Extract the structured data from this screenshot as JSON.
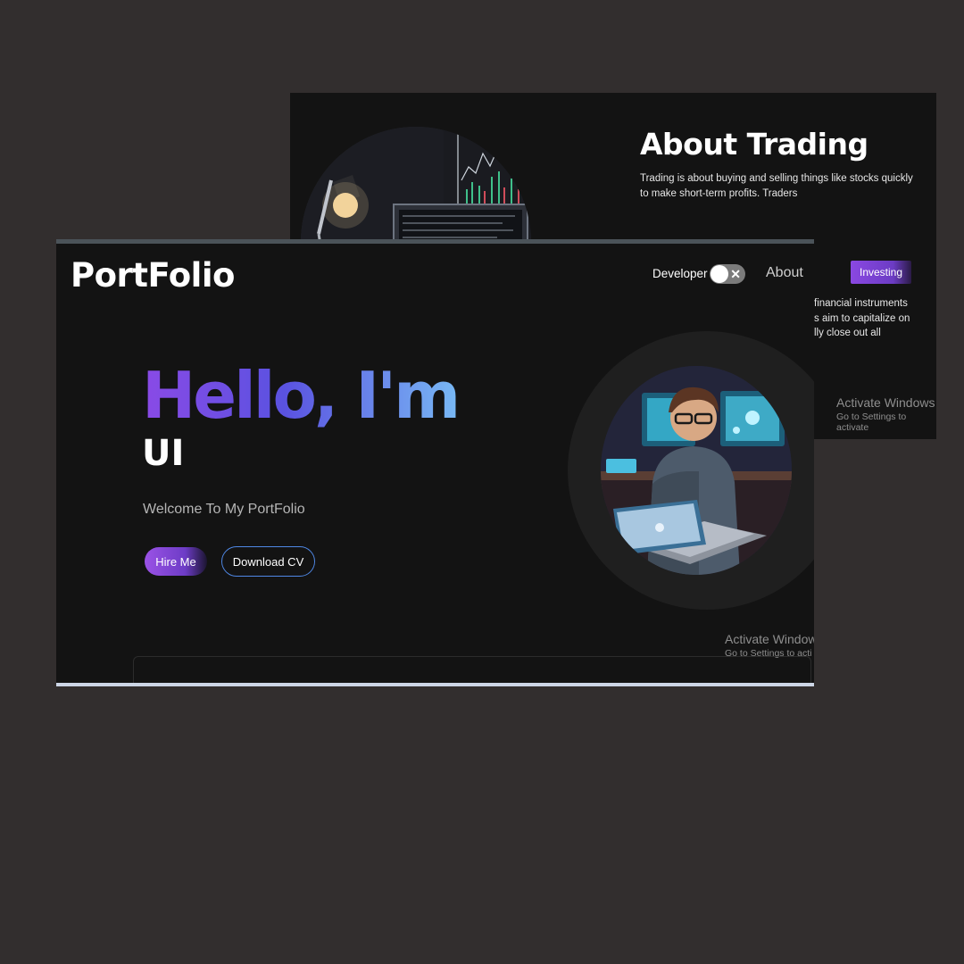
{
  "trading": {
    "title": "About Trading",
    "intro": "Trading is about buying and selling things like stocks quickly to make short-term profits. Traders",
    "lines_partial": [
      "financial instruments",
      "s aim to capitalize on",
      "lly close out all"
    ],
    "nav_investing": "Investing",
    "activate_title": "Activate Windows",
    "activate_sub": "Go to Settings to activate"
  },
  "portfolio": {
    "logo": "PortFolio",
    "toggle_label": "Developer",
    "toggle_icon": "close-icon",
    "nav_about": "About",
    "hero_hello": "Hello, I'm",
    "hero_role": "UI",
    "welcome": "Welcome To My PortFolio",
    "btn_hire": "Hire Me",
    "btn_cv": "Download CV",
    "activate_title": "Activate Window",
    "activate_sub": "Go to Settings to acti"
  },
  "colors": {
    "background": "#322e2e",
    "window_bg": "#131313",
    "accent_purple": "#8a4ae6",
    "accent_blue": "#4f88e6"
  }
}
